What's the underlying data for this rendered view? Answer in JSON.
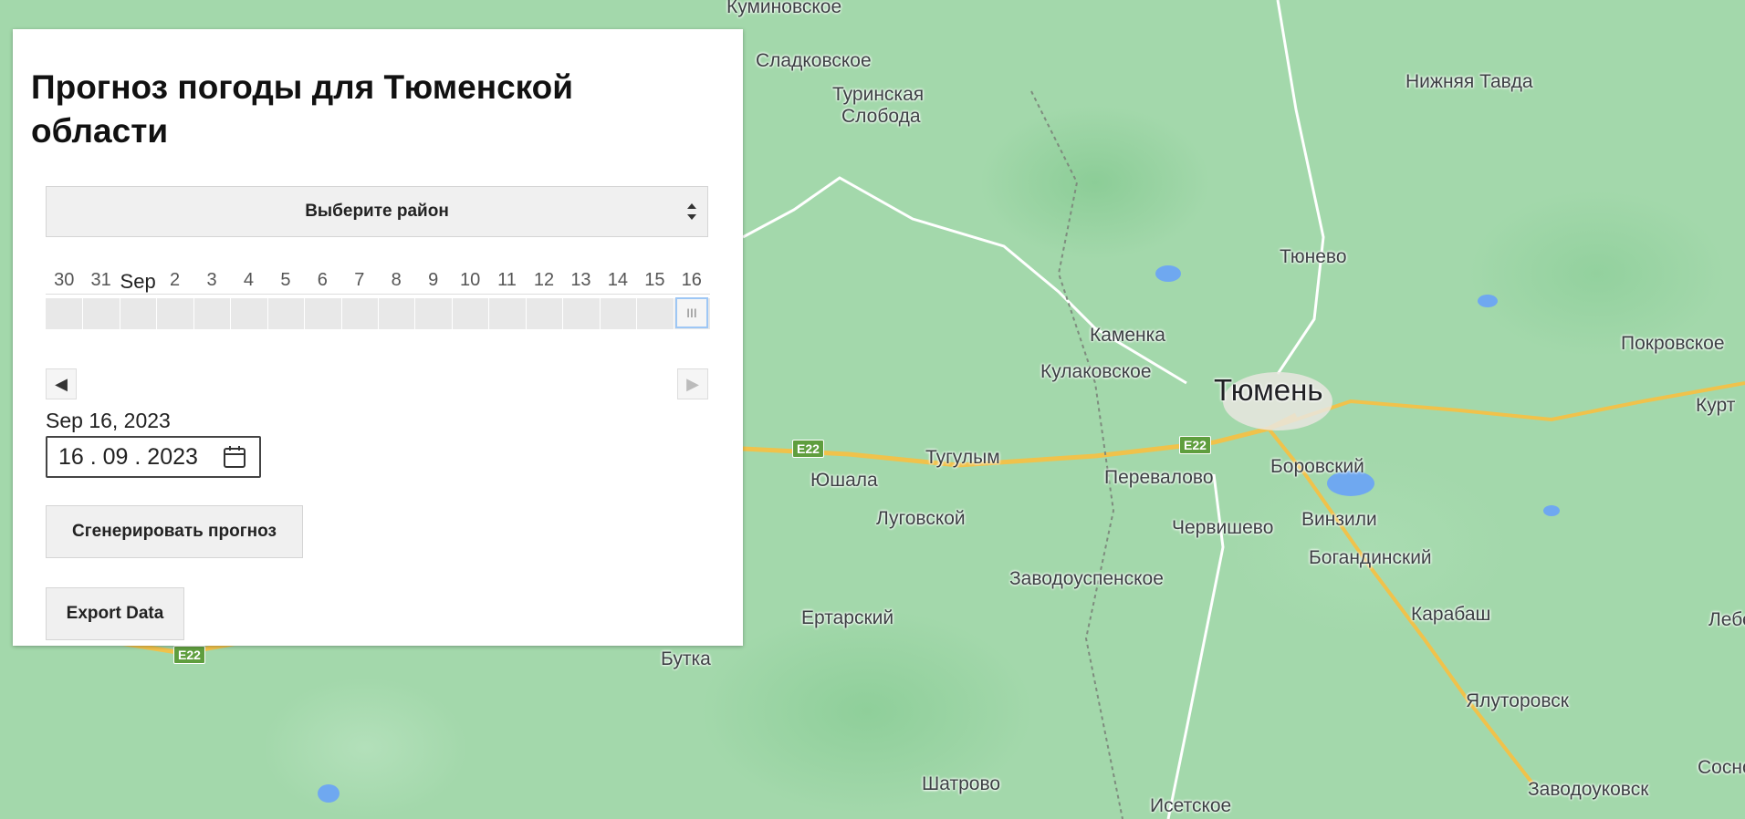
{
  "map": {
    "places": [
      {
        "name": "Куминовское"
      },
      {
        "name": "Сладковское"
      },
      {
        "name": "Туринская"
      },
      {
        "name": "Слобода"
      },
      {
        "name": "Нижняя Тавда"
      },
      {
        "name": "Тюнево"
      },
      {
        "name": "Покровское"
      },
      {
        "name": "Каменка"
      },
      {
        "name": "Кулаковское"
      },
      {
        "name": "Тюмень"
      },
      {
        "name": "Курт"
      },
      {
        "name": "Тугулым"
      },
      {
        "name": "Юшала"
      },
      {
        "name": "Перевалово"
      },
      {
        "name": "Боровский"
      },
      {
        "name": "Луговской"
      },
      {
        "name": "Червишево"
      },
      {
        "name": "Винзили"
      },
      {
        "name": "Богандинский"
      },
      {
        "name": "Заводоуспенское"
      },
      {
        "name": "Ертарский"
      },
      {
        "name": "Карабаш"
      },
      {
        "name": "Лебед"
      },
      {
        "name": "Бутка"
      },
      {
        "name": "Ялуторовск"
      },
      {
        "name": "Шатрово"
      },
      {
        "name": "Исетское"
      },
      {
        "name": "Заводоуковск"
      },
      {
        "name": "Сосно"
      }
    ],
    "road_label": "E22"
  },
  "panel": {
    "title": "Прогноз погоды для Тюменской области",
    "district_select": "Выберите район",
    "timeline": {
      "ticks": [
        "30",
        "31",
        "Sep",
        "2",
        "3",
        "4",
        "5",
        "6",
        "7",
        "8",
        "9",
        "10",
        "11",
        "12",
        "13",
        "14",
        "15",
        "16"
      ],
      "thumb_symbol": "III",
      "prev_symbol": "◀",
      "next_symbol": "▶"
    },
    "date_label": "Sep 16, 2023",
    "date_input_value": "16 . 09 . 2023",
    "generate_button": "Сгенерировать прогноз",
    "export_button": "Export Data"
  }
}
